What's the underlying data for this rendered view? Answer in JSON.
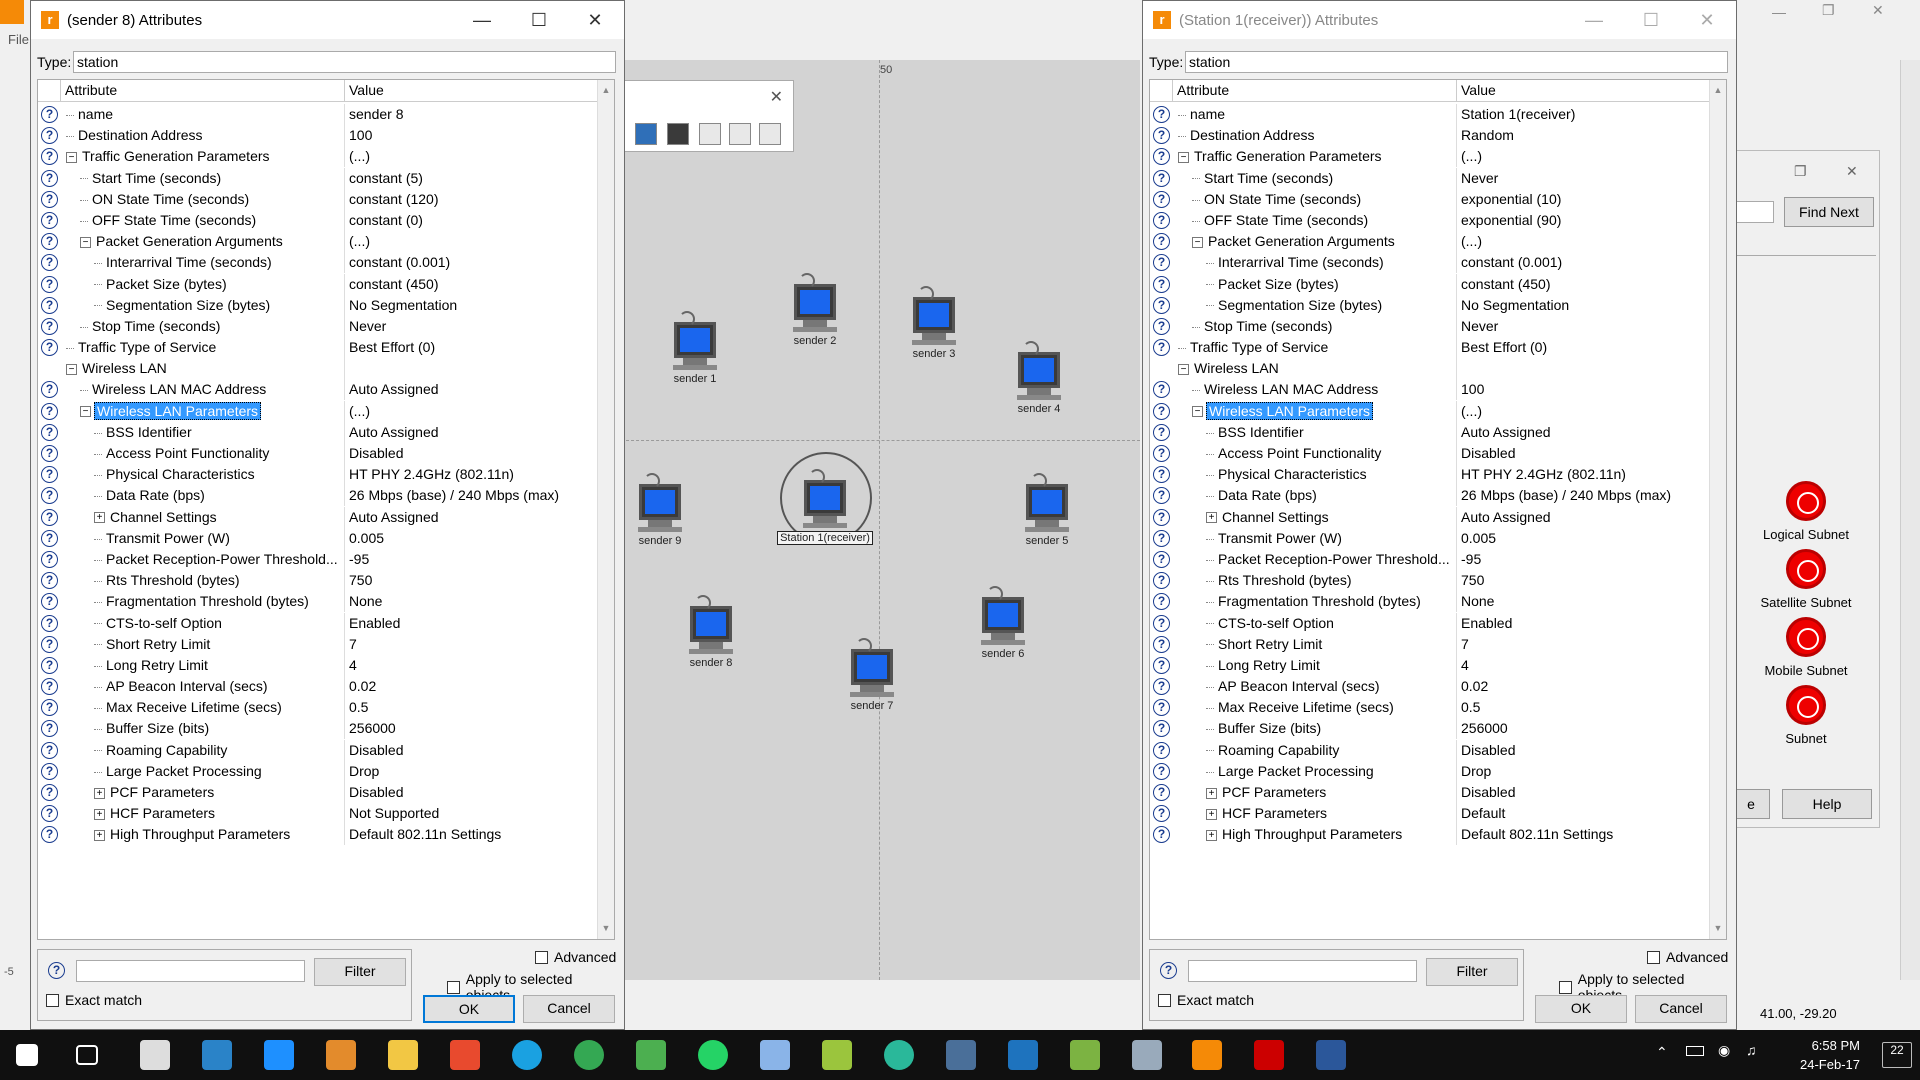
{
  "left_dialog": {
    "title": "(sender 8) Attributes",
    "type_label": "Type:",
    "type_value": "station",
    "col_attribute": "Attribute",
    "col_value": "Value",
    "rows": [
      {
        "attr": "name",
        "val": "sender 8",
        "level": 0,
        "exp": ""
      },
      {
        "attr": "Destination Address",
        "val": "100",
        "level": 0,
        "exp": ""
      },
      {
        "attr": "Traffic Generation Parameters",
        "val": "(...)",
        "level": 0,
        "exp": "minus"
      },
      {
        "attr": "Start Time (seconds)",
        "val": "constant (5)",
        "level": 1,
        "exp": ""
      },
      {
        "attr": "ON State Time (seconds)",
        "val": "constant (120)",
        "level": 1,
        "exp": ""
      },
      {
        "attr": "OFF State Time (seconds)",
        "val": "constant (0)",
        "level": 1,
        "exp": ""
      },
      {
        "attr": "Packet Generation Arguments",
        "val": "(...)",
        "level": 1,
        "exp": "minus"
      },
      {
        "attr": "Interarrival Time (seconds)",
        "val": "constant (0.001)",
        "level": 2,
        "exp": ""
      },
      {
        "attr": "Packet Size (bytes)",
        "val": "constant (450)",
        "level": 2,
        "exp": ""
      },
      {
        "attr": "Segmentation Size (bytes)",
        "val": "No Segmentation",
        "level": 2,
        "exp": ""
      },
      {
        "attr": "Stop Time (seconds)",
        "val": "Never",
        "level": 1,
        "exp": ""
      },
      {
        "attr": "Traffic Type of Service",
        "val": "Best Effort (0)",
        "level": 0,
        "exp": ""
      },
      {
        "attr": "Wireless LAN",
        "val": "",
        "level": 0,
        "exp": "minus",
        "noq": true
      },
      {
        "attr": "Wireless LAN MAC Address",
        "val": "Auto Assigned",
        "level": 1,
        "exp": ""
      },
      {
        "attr": "Wireless LAN Parameters",
        "val": "(...)",
        "level": 1,
        "exp": "minus",
        "sel": true
      },
      {
        "attr": "BSS Identifier",
        "val": "Auto Assigned",
        "level": 2,
        "exp": ""
      },
      {
        "attr": "Access Point Functionality",
        "val": "Disabled",
        "level": 2,
        "exp": ""
      },
      {
        "attr": "Physical Characteristics",
        "val": "HT PHY 2.4GHz (802.11n)",
        "level": 2,
        "exp": ""
      },
      {
        "attr": "Data Rate (bps)",
        "val": "26 Mbps (base) / 240 Mbps (max)",
        "level": 2,
        "exp": ""
      },
      {
        "attr": "Channel Settings",
        "val": "Auto Assigned",
        "level": 2,
        "exp": "plus"
      },
      {
        "attr": "Transmit Power (W)",
        "val": "0.005",
        "level": 2,
        "exp": ""
      },
      {
        "attr": "Packet Reception-Power Threshold...",
        "val": "-95",
        "level": 2,
        "exp": ""
      },
      {
        "attr": "Rts Threshold (bytes)",
        "val": "750",
        "level": 2,
        "exp": ""
      },
      {
        "attr": "Fragmentation Threshold (bytes)",
        "val": "None",
        "level": 2,
        "exp": ""
      },
      {
        "attr": "CTS-to-self Option",
        "val": "Enabled",
        "level": 2,
        "exp": ""
      },
      {
        "attr": "Short Retry Limit",
        "val": "7",
        "level": 2,
        "exp": ""
      },
      {
        "attr": "Long Retry Limit",
        "val": "4",
        "level": 2,
        "exp": ""
      },
      {
        "attr": "AP Beacon Interval (secs)",
        "val": "0.02",
        "level": 2,
        "exp": ""
      },
      {
        "attr": "Max Receive Lifetime (secs)",
        "val": "0.5",
        "level": 2,
        "exp": ""
      },
      {
        "attr": "Buffer Size (bits)",
        "val": "256000",
        "level": 2,
        "exp": ""
      },
      {
        "attr": "Roaming Capability",
        "val": "Disabled",
        "level": 2,
        "exp": ""
      },
      {
        "attr": "Large Packet Processing",
        "val": "Drop",
        "level": 2,
        "exp": ""
      },
      {
        "attr": "PCF Parameters",
        "val": "Disabled",
        "level": 2,
        "exp": "plus"
      },
      {
        "attr": "HCF Parameters",
        "val": "Not Supported",
        "level": 2,
        "exp": "plus"
      },
      {
        "attr": "High Throughput Parameters",
        "val": "Default 802.11n Settings",
        "level": 2,
        "exp": "plus"
      }
    ],
    "filter_label": "Filter",
    "exact_match": "Exact match",
    "advanced": "Advanced",
    "apply_selected": "Apply to selected objects",
    "ok": "OK",
    "cancel": "Cancel"
  },
  "right_dialog": {
    "title": "(Station 1(receiver)) Attributes",
    "type_label": "Type:",
    "type_value": "station",
    "col_attribute": "Attribute",
    "col_value": "Value",
    "rows": [
      {
        "attr": "name",
        "val": "Station 1(receiver)",
        "level": 0,
        "exp": ""
      },
      {
        "attr": "Destination Address",
        "val": "Random",
        "level": 0,
        "exp": ""
      },
      {
        "attr": "Traffic Generation Parameters",
        "val": "(...)",
        "level": 0,
        "exp": "minus"
      },
      {
        "attr": "Start Time (seconds)",
        "val": "Never",
        "level": 1,
        "exp": ""
      },
      {
        "attr": "ON State Time (seconds)",
        "val": "exponential (10)",
        "level": 1,
        "exp": ""
      },
      {
        "attr": "OFF State Time (seconds)",
        "val": "exponential (90)",
        "level": 1,
        "exp": ""
      },
      {
        "attr": "Packet Generation Arguments",
        "val": "(...)",
        "level": 1,
        "exp": "minus"
      },
      {
        "attr": "Interarrival Time (seconds)",
        "val": "constant (0.001)",
        "level": 2,
        "exp": ""
      },
      {
        "attr": "Packet Size (bytes)",
        "val": "constant (450)",
        "level": 2,
        "exp": ""
      },
      {
        "attr": "Segmentation Size (bytes)",
        "val": "No Segmentation",
        "level": 2,
        "exp": ""
      },
      {
        "attr": "Stop Time (seconds)",
        "val": "Never",
        "level": 1,
        "exp": ""
      },
      {
        "attr": "Traffic Type of Service",
        "val": "Best Effort (0)",
        "level": 0,
        "exp": ""
      },
      {
        "attr": "Wireless LAN",
        "val": "",
        "level": 0,
        "exp": "minus",
        "noq": true
      },
      {
        "attr": "Wireless LAN MAC Address",
        "val": "100",
        "level": 1,
        "exp": ""
      },
      {
        "attr": "Wireless LAN Parameters",
        "val": "(...)",
        "level": 1,
        "exp": "minus",
        "sel": true
      },
      {
        "attr": "BSS Identifier",
        "val": "Auto Assigned",
        "level": 2,
        "exp": ""
      },
      {
        "attr": "Access Point Functionality",
        "val": "Disabled",
        "level": 2,
        "exp": ""
      },
      {
        "attr": "Physical Characteristics",
        "val": "HT PHY 2.4GHz (802.11n)",
        "level": 2,
        "exp": ""
      },
      {
        "attr": "Data Rate (bps)",
        "val": "26 Mbps (base) / 240 Mbps (max)",
        "level": 2,
        "exp": ""
      },
      {
        "attr": "Channel Settings",
        "val": "Auto Assigned",
        "level": 2,
        "exp": "plus"
      },
      {
        "attr": "Transmit Power (W)",
        "val": "0.005",
        "level": 2,
        "exp": ""
      },
      {
        "attr": "Packet Reception-Power Threshold...",
        "val": "-95",
        "level": 2,
        "exp": ""
      },
      {
        "attr": "Rts Threshold (bytes)",
        "val": "750",
        "level": 2,
        "exp": ""
      },
      {
        "attr": "Fragmentation Threshold (bytes)",
        "val": "None",
        "level": 2,
        "exp": ""
      },
      {
        "attr": "CTS-to-self Option",
        "val": "Enabled",
        "level": 2,
        "exp": ""
      },
      {
        "attr": "Short Retry Limit",
        "val": "7",
        "level": 2,
        "exp": ""
      },
      {
        "attr": "Long Retry Limit",
        "val": "4",
        "level": 2,
        "exp": ""
      },
      {
        "attr": "AP Beacon Interval (secs)",
        "val": "0.02",
        "level": 2,
        "exp": ""
      },
      {
        "attr": "Max Receive Lifetime (secs)",
        "val": "0.5",
        "level": 2,
        "exp": ""
      },
      {
        "attr": "Buffer Size (bits)",
        "val": "256000",
        "level": 2,
        "exp": ""
      },
      {
        "attr": "Roaming Capability",
        "val": "Disabled",
        "level": 2,
        "exp": ""
      },
      {
        "attr": "Large Packet Processing",
        "val": "Drop",
        "level": 2,
        "exp": ""
      },
      {
        "attr": "PCF Parameters",
        "val": "Disabled",
        "level": 2,
        "exp": "plus"
      },
      {
        "attr": "HCF Parameters",
        "val": "Default",
        "level": 2,
        "exp": "plus"
      },
      {
        "attr": "High Throughput Parameters",
        "val": "Default 802.11n Settings",
        "level": 2,
        "exp": "plus"
      }
    ],
    "filter_label": "Filter",
    "exact_match": "Exact match",
    "advanced": "Advanced",
    "apply_selected": "Apply to selected objects",
    "ok": "OK",
    "cancel": "Cancel"
  },
  "background": {
    "menu_partial": "File",
    "ruler_label": "50",
    "nodes": [
      {
        "label": "sender 1",
        "id": "sender-1"
      },
      {
        "label": "sender 2",
        "id": "sender-2"
      },
      {
        "label": "sender 3",
        "id": "sender-3"
      },
      {
        "label": "sender 4",
        "id": "sender-4"
      },
      {
        "label": "sender 5",
        "id": "sender-5"
      },
      {
        "label": "sender 6",
        "id": "sender-6"
      },
      {
        "label": "sender 7",
        "id": "sender-7"
      },
      {
        "label": "sender 8",
        "id": "sender-8"
      },
      {
        "label": "sender 9",
        "id": "sender-9"
      },
      {
        "label": "Station 1(receiver)",
        "id": "station-1-receiver"
      }
    ],
    "find_next": "Find Next",
    "help": "Help",
    "partial_button": "e",
    "subnets": [
      "Logical Subnet",
      "Satellite Subnet",
      "Mobile Subnet",
      "Subnet"
    ],
    "coords": "41.00, -29.20",
    "left_edge_marker": "-5"
  },
  "taskbar": {
    "time": "6:58 PM",
    "date": "24-Feb-17",
    "notifications": "22",
    "accent": "#f58a07"
  }
}
